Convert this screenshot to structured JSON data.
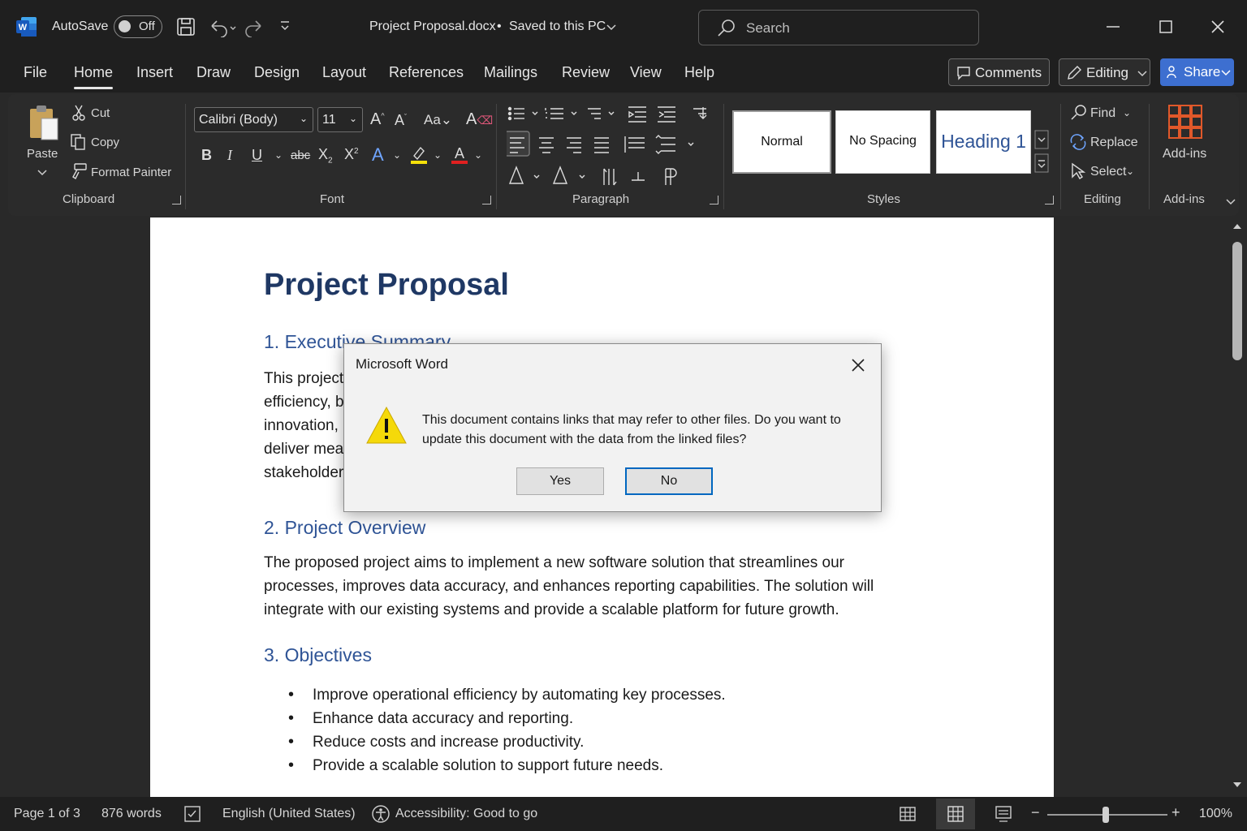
{
  "app": {
    "autosave_label": "AutoSave",
    "autosave_state": "Off",
    "doc_title": "Project Proposal.docx",
    "save_status": "Saved to this PC",
    "search_placeholder": "Search"
  },
  "menu": {
    "tabs": [
      "File",
      "Home",
      "Insert",
      "Draw",
      "Design",
      "Layout",
      "References",
      "Mailings",
      "Review",
      "View",
      "Help"
    ],
    "active_tab": "Home",
    "comments_label": "Comments",
    "editing_label": "Editing",
    "share_label": "Share"
  },
  "ribbon": {
    "clipboard": {
      "paste": "Paste",
      "cut": "Cut",
      "copy": "Copy",
      "format_painter": "Format Painter",
      "label": "Clipboard"
    },
    "font": {
      "family": "Calibri (Body)",
      "size": "11",
      "label": "Font"
    },
    "paragraph": {
      "label": "Paragraph"
    },
    "styles": {
      "items": [
        "Normal",
        "No Spacing",
        "Heading 1"
      ],
      "label": "Styles"
    },
    "editing": {
      "find": "Find",
      "replace": "Replace",
      "select": "Select",
      "label": "Editing"
    },
    "addins": {
      "button": "Add-ins",
      "label": "Add-ins"
    }
  },
  "document": {
    "title": "Project Proposal",
    "h1": "1. Executive Summary",
    "p1_lines": [
      "This project",
      "efficiency, b",
      "innovation,",
      "deliver mea",
      "stakeholder"
    ],
    "h2": "2. Project Overview",
    "p2_lines": [
      "The proposed project aims to implement a new software solution that streamlines our",
      "processes, improves data accuracy, and enhances reporting capabilities. The solution will",
      "integrate with our existing systems and provide a scalable platform for future growth."
    ],
    "h3": "3. Objectives",
    "bullets": [
      "Improve operational efficiency by automating key processes.",
      "Enhance data accuracy and reporting.",
      "Reduce costs and increase productivity.",
      "Provide a scalable solution to support future needs."
    ]
  },
  "dialog": {
    "title": "Microsoft Word",
    "message_line1": "This document contains links that may refer to other files. Do you want to",
    "message_line2": "update this document with the data from the linked files?",
    "yes": "Yes",
    "no": "No"
  },
  "status": {
    "page": "Page 1 of 3",
    "words": "876 words",
    "language": "English (United States)",
    "accessibility": "Accessibility: Good to go",
    "zoom": "100%"
  },
  "colors": {
    "title_color": "#1f3864",
    "heading_color": "#2f5496",
    "share_button": "#3d6fd0",
    "dialog_default_border": "#0067c0",
    "warning_yellow": "#f5d90a"
  }
}
